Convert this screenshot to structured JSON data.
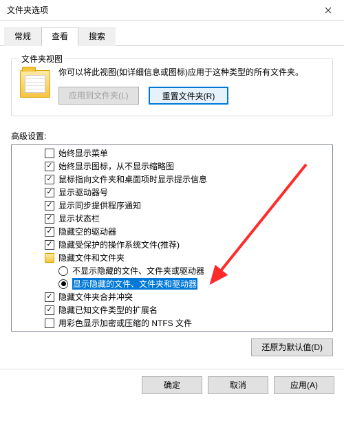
{
  "window": {
    "title": "文件夹选项"
  },
  "tabs": {
    "general": "常规",
    "view": "查看",
    "search": "搜索"
  },
  "folderViews": {
    "legend": "文件夹视图",
    "desc": "你可以将此视图(如详细信息或图标)应用于这种类型的所有文件夹。",
    "applyBtn": "应用到文件夹(L)",
    "resetBtn": "重置文件夹(R)"
  },
  "advanced": {
    "label": "高级设置:",
    "items": [
      {
        "type": "check",
        "state": "unchecked",
        "label": "始终显示菜单"
      },
      {
        "type": "check",
        "state": "checked",
        "label": "始终显示图标，从不显示缩略图"
      },
      {
        "type": "check",
        "state": "checked",
        "label": "鼠标指向文件夹和桌面项时显示提示信息"
      },
      {
        "type": "check",
        "state": "checked",
        "label": "显示驱动器号"
      },
      {
        "type": "check",
        "state": "checked",
        "label": "显示同步提供程序通知"
      },
      {
        "type": "check",
        "state": "checked",
        "label": "显示状态栏"
      },
      {
        "type": "check",
        "state": "checked",
        "label": "隐藏空的驱动器"
      },
      {
        "type": "check",
        "state": "checked",
        "label": "隐藏受保护的操作系统文件(推荐)"
      },
      {
        "type": "folder",
        "label": "隐藏文件和文件夹"
      },
      {
        "type": "radio",
        "state": "off",
        "indent": 2,
        "label": "不显示隐藏的文件、文件夹或驱动器"
      },
      {
        "type": "radio",
        "state": "on",
        "indent": 2,
        "selected": true,
        "label": "显示隐藏的文件、文件夹和驱动器"
      },
      {
        "type": "check",
        "state": "checked",
        "label": "隐藏文件夹合并冲突"
      },
      {
        "type": "check",
        "state": "checked",
        "label": "隐藏已知文件类型的扩展名"
      },
      {
        "type": "check",
        "state": "unchecked",
        "label": "用彩色显示加密或压缩的 NTFS 文件"
      }
    ]
  },
  "restoreDefaultsBtn": "还原为默认值(D)",
  "bottom": {
    "ok": "确定",
    "cancel": "取消",
    "apply": "应用(A)"
  }
}
